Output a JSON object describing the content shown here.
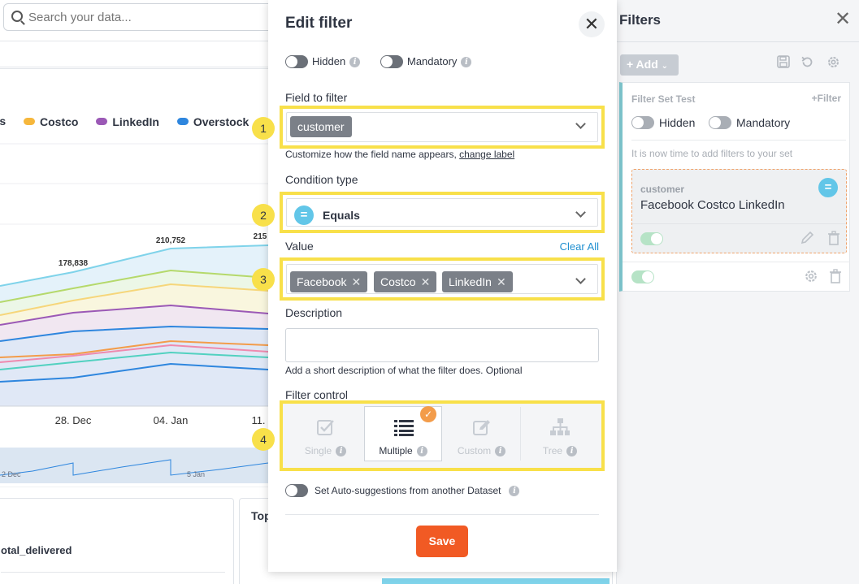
{
  "search": {
    "placeholder": "Search your data..."
  },
  "legend": [
    {
      "label": "'s",
      "color": "#9aa0a8",
      "partial": true
    },
    {
      "label": "Costco",
      "color": "#f6b73c"
    },
    {
      "label": "LinkedIn",
      "color": "#9b59b6"
    },
    {
      "label": "Overstock",
      "color": "#2e86de"
    }
  ],
  "chart": {
    "x_labels": [
      "28. Dec",
      "04. Jan",
      "11."
    ],
    "data_labels": [
      "178,838",
      "210,752",
      "215"
    ],
    "series_colors": [
      "#7fd3ea",
      "#b5d96b",
      "#f6d67a",
      "#9b59b6",
      "#2e86de",
      "#f39c4a",
      "#ef8aae",
      "#52d1c0",
      "#2e86de"
    ],
    "navigator_labels": [
      "2 Dec",
      "5 Jan"
    ]
  },
  "bottom": {
    "card1_text": "otal_delivered",
    "card2_title": "Top"
  },
  "modal": {
    "title": "Edit filter",
    "hidden_label": "Hidden",
    "mandatory_label": "Mandatory",
    "field_label": "Field to filter",
    "field_value": "customer",
    "field_hint": "Customize how the field name appears,",
    "change_label": "change label",
    "condition_label": "Condition type",
    "condition_value": "Equals",
    "condition_symbol": "=",
    "value_label": "Value",
    "clear_all": "Clear All",
    "values": [
      "Facebook",
      "Costco",
      "LinkedIn"
    ],
    "description_label": "Description",
    "description_value": "",
    "description_hint": "Add a short description of what the filter does. Optional",
    "filter_control_label": "Filter control",
    "controls": [
      {
        "label": "Single",
        "selected": false
      },
      {
        "label": "Multiple",
        "selected": true
      },
      {
        "label": "Custom",
        "selected": false
      },
      {
        "label": "Tree",
        "selected": false
      }
    ],
    "auto_suggest_label": "Set Auto-suggestions from another Dataset",
    "save_label": "Save",
    "steps": [
      "1",
      "2",
      "3",
      "4"
    ]
  },
  "filters_panel": {
    "title": "Filters",
    "add_label": "+ Add",
    "set_title": "Filter Set Test",
    "add_filter": "+Filter",
    "hidden_label": "Hidden",
    "mandatory_label": "Mandatory",
    "hint": "It is now time to add filters to your set",
    "card": {
      "field": "customer",
      "values": "Facebook Costco LinkedIn",
      "symbol": "="
    }
  },
  "colors": {
    "highlight": "#f8e04a",
    "save": "#f15a24",
    "accent": "#62c6e8",
    "check": "#f39c4a"
  }
}
